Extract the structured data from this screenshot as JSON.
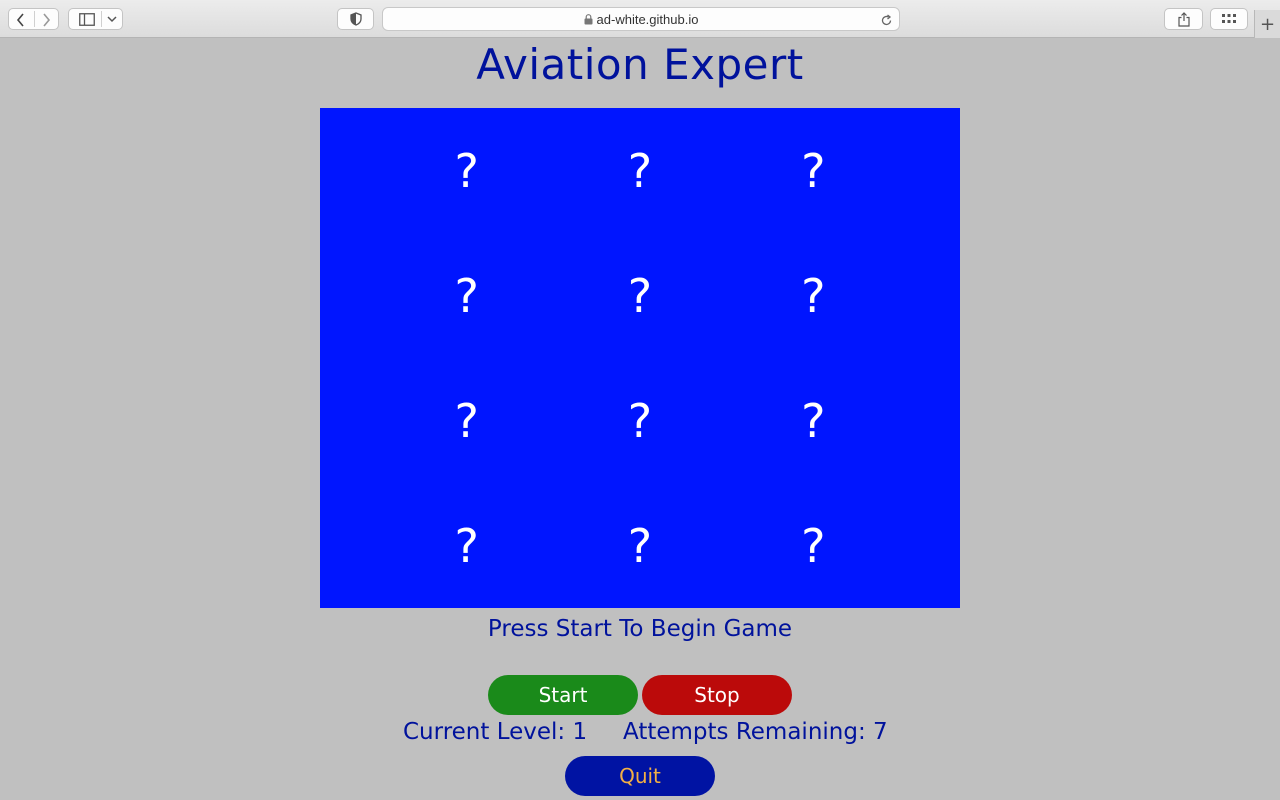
{
  "browser": {
    "url": "ad-white.github.io",
    "new_tab_label": "+"
  },
  "page": {
    "title": "Aviation Expert",
    "tiles": [
      "?",
      "?",
      "?",
      "?",
      "?",
      "?",
      "?",
      "?",
      "?",
      "?",
      "?",
      "?"
    ],
    "message": "Press Start To Begin Game",
    "start_label": "Start",
    "stop_label": "Stop",
    "quit_label": "Quit",
    "level_label": "Current Level:",
    "level_value": "1",
    "attempts_label": "Attempts Remaining:",
    "attempts_value": "7"
  },
  "colors": {
    "background": "#c0c0c0",
    "title_text": "#00129c",
    "board": "#0015ff",
    "start_button": "#1a8a1a",
    "stop_button": "#bb0a0a",
    "quit_button": "#0013a3",
    "quit_text": "#f2b045"
  },
  "icons": [
    "back-icon",
    "forward-icon",
    "sidebar-icon",
    "chevron-down-icon",
    "shield-icon",
    "lock-icon",
    "reload-icon",
    "share-icon",
    "tab-overview-icon"
  ]
}
